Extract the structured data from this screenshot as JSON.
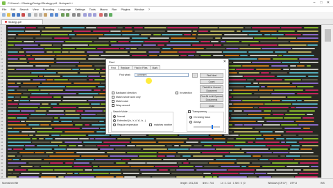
{
  "window": {
    "title": "C:\\Users\\...\\StrategyDesign\\Strategy.pdf - Notepad++",
    "minimize": "–",
    "maximize": "□",
    "close": "✕"
  },
  "menu": [
    "File",
    "Edit",
    "Search",
    "View",
    "Encoding",
    "Language",
    "Settings",
    "Tools",
    "Macro",
    "Run",
    "Plugins",
    "Window",
    "?"
  ],
  "tab": {
    "label": "Strategy.pdf",
    "close": "×"
  },
  "editor": {
    "line_numbers": [
      "1",
      "2",
      "3",
      "4",
      "5",
      "6",
      "7",
      "8",
      "9",
      "10",
      "11",
      "12",
      "13",
      "14",
      "15",
      "16",
      "17",
      "18",
      "19",
      "20",
      "21",
      "22",
      "23",
      "24",
      "25",
      "26",
      "27",
      "28",
      "29",
      "30",
      "31",
      "32",
      "33",
      "34",
      "35",
      "36",
      "37",
      "38",
      "39",
      "40",
      "41",
      "42",
      "43",
      "44"
    ]
  },
  "status": {
    "type": "Normal text file",
    "length": "length : 201,236",
    "lines": "lines : 744",
    "position": "Ln : 1   Col : 1   Sel : 0 | 0",
    "eol": "Windows (CR LF)",
    "encoding": "UTF-8",
    "mode": "INS"
  },
  "dialog": {
    "title": "Find",
    "close": "✕",
    "tabs": [
      "Find",
      "Replace",
      "Find in Files",
      "Mark"
    ],
    "find_label": "Find what :",
    "find_value": "comment",
    "buttons": {
      "find_next": "Find Next",
      "count": "Count",
      "find_all_current": "Find All in Current Document",
      "find_all_opened": "Find All in All Opened Documents",
      "close": "Close",
      "dots": "..."
    },
    "options": {
      "backward": "Backward direction",
      "whole_word": "Match whole word only",
      "match_case": "Match case",
      "wrap": "Wrap around",
      "in_selection": "In selection"
    },
    "search_mode": {
      "title": "Search Mode",
      "normal": "Normal",
      "extended": "Extended (\\n, \\r, \\t, \\0, \\x...)",
      "regex": "Regular expression",
      "dot_newline": ". matches newline"
    },
    "transparency": {
      "title": "Transparency",
      "on_losing_focus": "On losing focus",
      "always": "Always"
    }
  }
}
